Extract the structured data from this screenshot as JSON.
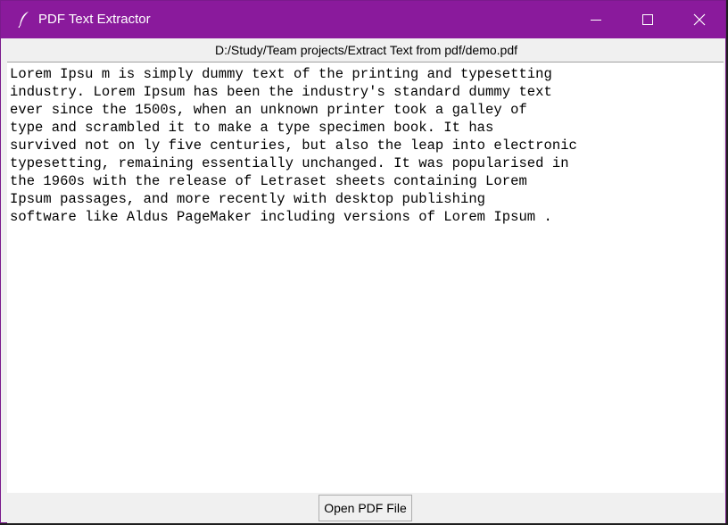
{
  "window": {
    "title": "PDF Text Extractor",
    "icon": "feather-icon",
    "accent_color": "#8a1a9c"
  },
  "pathbar": {
    "file_path": "D:/Study/Team projects/Extract Text from pdf/demo.pdf"
  },
  "content": {
    "lines": [
      "Lorem Ipsu m is simply dummy text of the printing and typesetting",
      "industry. Lorem Ipsum has been the industry's standard dummy text",
      "ever since the 1500s, when an unknown printer took a galley of",
      "type and scrambled it to make a type specimen book. It has",
      "survived not on ly five centuries, but also the leap into electronic",
      "typesetting, remaining essentially unchanged. It was popularised in",
      "the 1960s with the release of Letraset sheets containing Lorem",
      "Ipsum passages, and more recently with desktop publishing",
      "software like Aldus PageMaker including versions of Lorem Ipsum ."
    ]
  },
  "footer": {
    "open_button_label": "Open PDF File"
  }
}
